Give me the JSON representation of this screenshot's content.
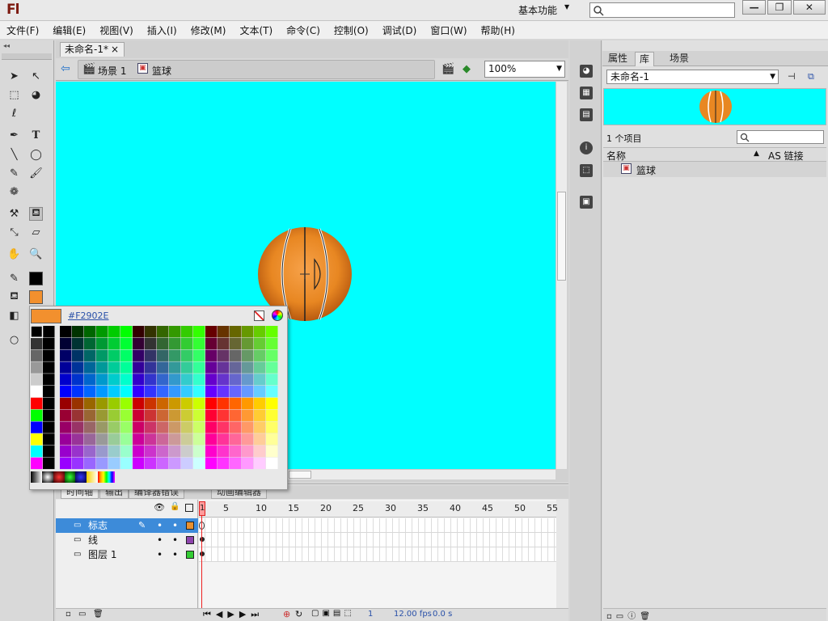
{
  "app": {
    "logo": "Fl",
    "workspace": "基本功能"
  },
  "menu": [
    "文件(F)",
    "编辑(E)",
    "视图(V)",
    "插入(I)",
    "修改(M)",
    "文本(T)",
    "命令(C)",
    "控制(O)",
    "调试(D)",
    "窗口(W)",
    "帮助(H)"
  ],
  "document": {
    "tab_label": "未命名-1*",
    "tab_close": "×",
    "scene": "场景 1",
    "symbol": "篮球",
    "zoom": "100%"
  },
  "colors": {
    "stage": "#00ffff",
    "fill": "#f2902e",
    "selection": "#3d8bd9"
  },
  "palette": {
    "hex": "#F2902E"
  },
  "timeline": {
    "tabs": [
      "时间轴",
      "输出",
      "编译器错误",
      "动画编辑器"
    ],
    "ticks": [
      "1",
      "5",
      "10",
      "15",
      "20",
      "25",
      "30",
      "35",
      "40",
      "45",
      "50",
      "55"
    ],
    "layers": [
      {
        "name": "标志",
        "color": "#e8902e",
        "selected": true
      },
      {
        "name": "线",
        "color": "#8e44ad",
        "selected": false
      },
      {
        "name": "图层 1",
        "color": "#33cc33",
        "selected": false
      }
    ],
    "status": {
      "frame": "1",
      "fps": "12.00 fps",
      "time": "0.0 s"
    }
  },
  "library": {
    "tabs": [
      "属性",
      "库",
      "场景"
    ],
    "document": "未命名-1",
    "count": "1 个项目",
    "col_name": "名称",
    "col_link": "AS 链接",
    "items": [
      "篮球"
    ]
  }
}
